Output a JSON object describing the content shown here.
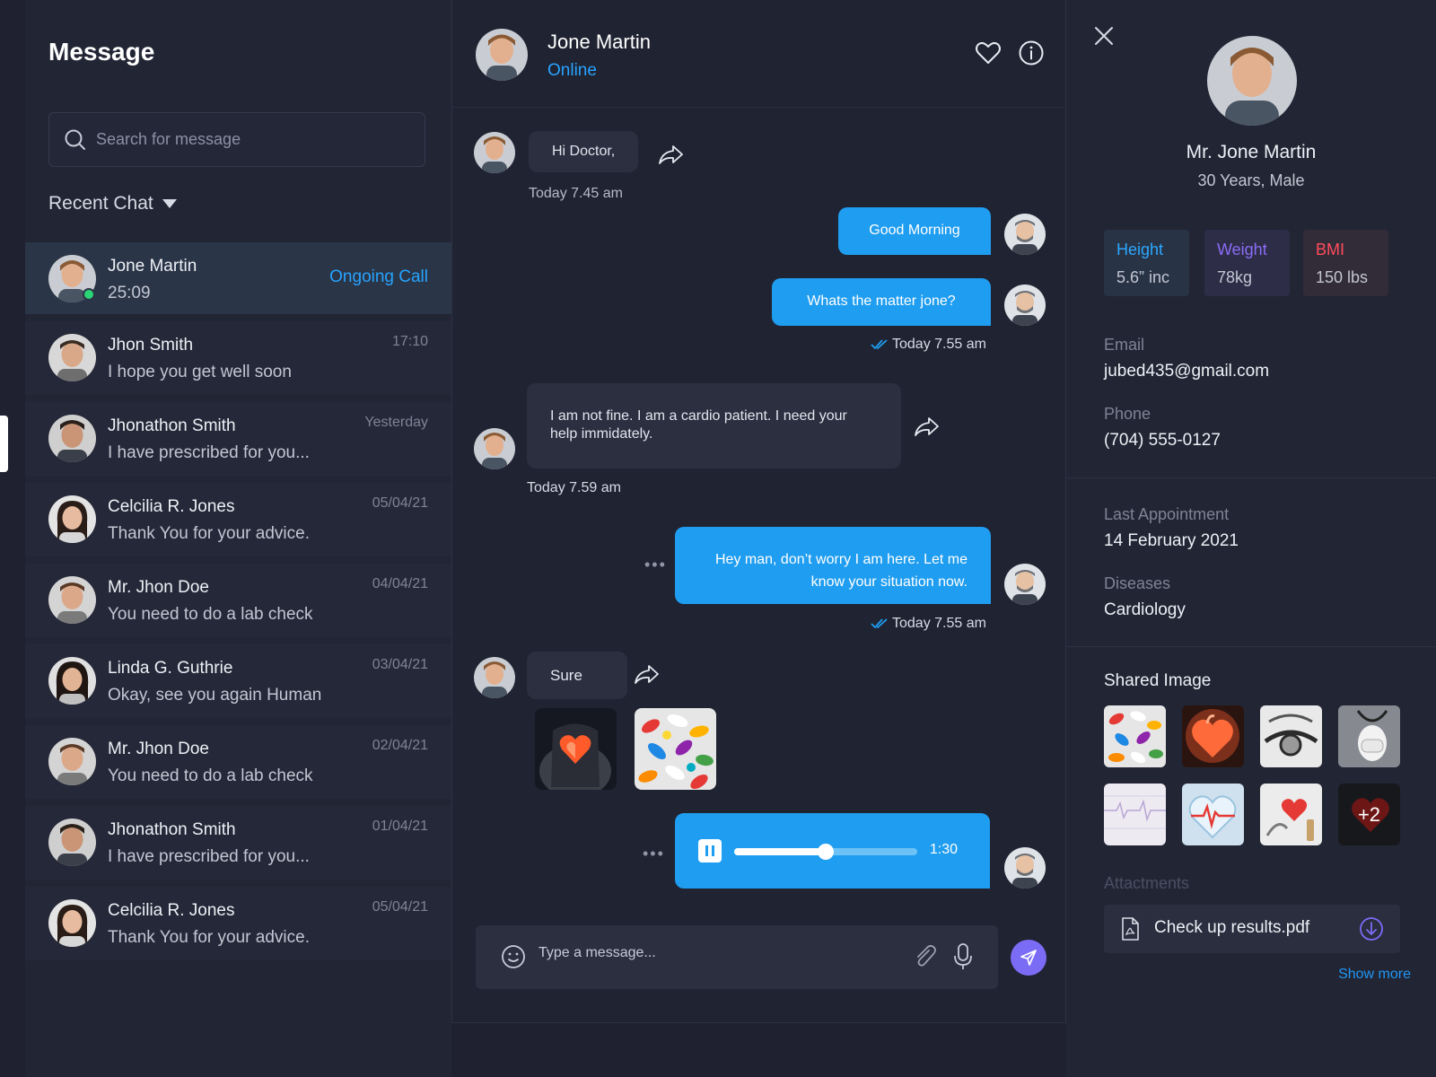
{
  "sidebar": {
    "title": "Message",
    "search_placeholder": "Search for message",
    "recent_label": "Recent Chat",
    "chats": [
      {
        "name": "Jone Martin",
        "message": "25:09",
        "status": "Ongoing Call",
        "online": true
      },
      {
        "name": "Jhon Smith",
        "message": "I hope you get well soon",
        "time": "17:10"
      },
      {
        "name": "Jhonathon Smith",
        "message": "I have prescribed for you...",
        "time": "Yesterday"
      },
      {
        "name": "Celcilia R. Jones",
        "message": "Thank You for your advice.",
        "time": "05/04/21"
      },
      {
        "name": "Mr. Jhon Doe",
        "message": "You need to do a lab check",
        "time": "04/04/21"
      },
      {
        "name": "Linda G. Guthrie",
        "message": "Okay, see you again Human",
        "time": "03/04/21"
      },
      {
        "name": "Mr. Jhon Doe",
        "message": "You need to do a lab check",
        "time": "02/04/21"
      },
      {
        "name": "Jhonathon Smith",
        "message": "I have prescribed for you...",
        "time": "01/04/21"
      },
      {
        "name": "Celcilia R. Jones",
        "message": "Thank You for your advice.",
        "time": "05/04/21"
      }
    ]
  },
  "conversation": {
    "contact_name": "Jone Martin",
    "contact_status": "Online",
    "messages": [
      {
        "text": "Hi Doctor,",
        "time": "Today 7.45 am"
      },
      {
        "text": "Good Morning"
      },
      {
        "text": "Whats the matter jone?",
        "time": "Today 7.55 am"
      },
      {
        "text": "I am not fine. I am a cardio patient. I need your help immidately.",
        "time": "Today 7.59 am"
      },
      {
        "text": "Hey man, don’t worry I am here. Let me know your situation now.",
        "time": "Today 7.55 am"
      },
      {
        "text": "Sure"
      }
    ],
    "voice_duration": "1:30",
    "voice_progress": 0.5,
    "composer_placeholder": "Type a message..."
  },
  "profile": {
    "name": "Mr. Jone Martin",
    "subtitle": "30 Years, Male",
    "metrics": [
      {
        "label": "Height",
        "value": "5.6” inc",
        "color": "#2ca8ff",
        "bg": "#283345"
      },
      {
        "label": "Weight",
        "value": "78kg",
        "color": "#8b6cf6",
        "bg": "#2d2d47"
      },
      {
        "label": "BMI",
        "value": "150 lbs",
        "color": "#ff4d5a",
        "bg": "#322b38"
      }
    ],
    "email_label": "Email",
    "email": "jubed435@gmail.com",
    "phone_label": "Phone",
    "phone": "(704) 555-0127",
    "last_appointment_label": "Last Appointment",
    "last_appointment": "14 February 2021",
    "diseases_label": "Diseases",
    "diseases": "Cardiology",
    "shared_title": "Shared Image",
    "shared_more": "+2",
    "attachments_title": "Attactments",
    "attachment_name": "Check up results.pdf",
    "show_more": "Show more"
  },
  "colors": {
    "accent_blue": "#1f9df0",
    "send_purple": "#7b6cf6",
    "online_green": "#2bd576"
  }
}
